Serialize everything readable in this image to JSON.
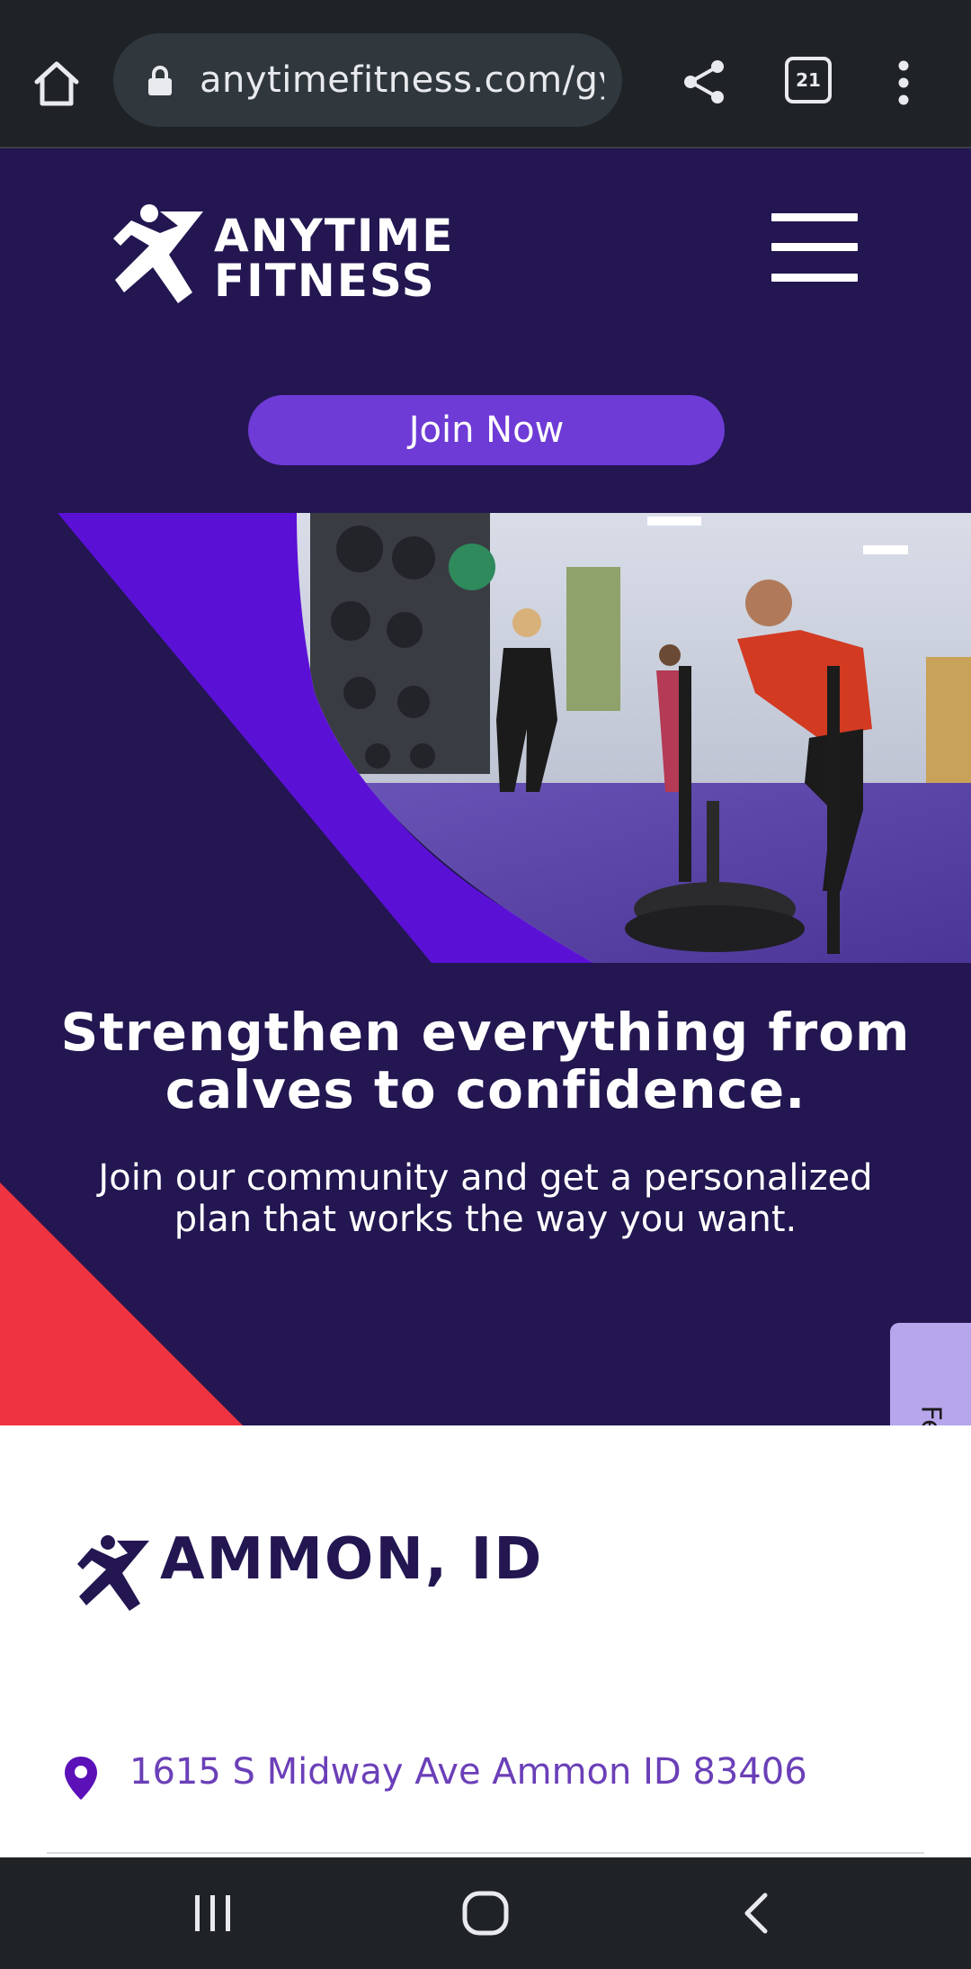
{
  "browser": {
    "url": "anytimefitness.com/gy",
    "tab_count": "21",
    "icons": [
      "home-icon",
      "lock-icon",
      "share-icon",
      "tabs-icon",
      "more-vert-icon"
    ]
  },
  "header": {
    "logo_line1": "ANYTIME",
    "logo_line2": "FITNESS",
    "join_label": "Join Now",
    "menu_icon": "hamburger-icon"
  },
  "hero": {
    "title_line1": "Strengthen everything from",
    "title_line2": "calves to confidence.",
    "subtitle_line1": "Join our community and get a personalized",
    "subtitle_line2": "plan that works the way you want."
  },
  "feedback_label": "Feedback",
  "location": {
    "title": "AMMON, ID",
    "address": "1615 S Midway Ave Ammon ID 83406"
  },
  "navbar": {
    "icons": [
      "recents-icon",
      "home-circle-icon",
      "back-icon"
    ]
  },
  "colors": {
    "brand_dark": "#231651",
    "brand_purple": "#6e3bd6",
    "accent_red": "#ef3340",
    "address_purple": "#6b3fb8",
    "feedback_bg": "#b8a6ec"
  }
}
